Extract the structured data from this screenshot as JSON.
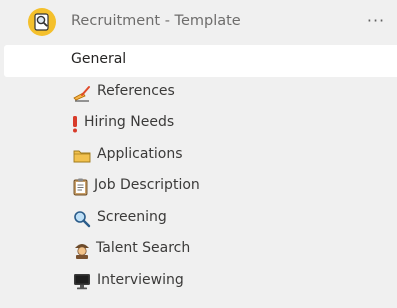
{
  "team": {
    "name": "Recruitment - Template",
    "avatar_icon": "magnifier-on-note-icon",
    "avatar_color": "#f4c02c",
    "more_label": "···"
  },
  "channels": [
    {
      "label": "General",
      "selected": true,
      "icon": ""
    },
    {
      "label": "References",
      "selected": false,
      "icon": "writing-hand-icon"
    },
    {
      "label": "Hiring Needs",
      "selected": false,
      "icon": "exclamation-icon"
    },
    {
      "label": "Applications",
      "selected": false,
      "icon": "folder-icon"
    },
    {
      "label": "Job Description",
      "selected": false,
      "icon": "clipboard-icon"
    },
    {
      "label": "Screening",
      "selected": false,
      "icon": "magnifier-icon"
    },
    {
      "label": "Talent Search",
      "selected": false,
      "icon": "detective-icon"
    },
    {
      "label": "Interviewing",
      "selected": false,
      "icon": "computer-monitor-icon"
    }
  ]
}
